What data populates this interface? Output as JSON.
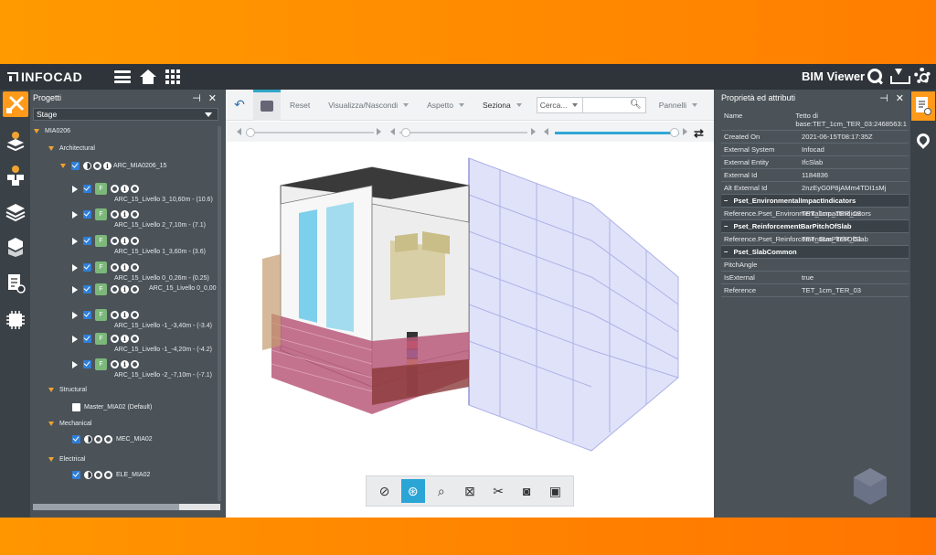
{
  "app": {
    "logo": "INFOCAD",
    "viewer_title": "BIM Viewer",
    "icons": [
      "hamburger-icon",
      "home-icon",
      "grid-icon",
      "search-icon",
      "download-icon",
      "gear-icon"
    ]
  },
  "projects_panel": {
    "title": "Progetti",
    "stage_value": "Stage",
    "tree": {
      "root": "MIA0206",
      "architectural": "Architectural",
      "arc_model": "ARC_MIA0206_15",
      "levels": [
        "ARC_15_Livello 3_10,60m - (10.6)",
        "ARC_15_Livello 2_7,10m - (7.1)",
        "ARC_15_Livello 1_3,60m - (3.6)",
        "ARC_15_Livello 0_0,26m - (0.25)",
        "ARC_15_Livello 0_0,00",
        "ARC_15_Livello -1_-3,40m - (-3.4)",
        "ARC_15_Livello -1_-4,20m - (-4.2)",
        "ARC_15_Livello -2_-7,10m - (-7.1)"
      ],
      "structural": "Structural",
      "structural_model": "Master_MIA02 (Default)",
      "mechanical": "Mechanical",
      "mechanical_model": "MEC_MIA02",
      "electrical": "Electrical",
      "electrical_model": "ELE_MIA02",
      "f_badge": "F",
      "info_glyph": "i"
    }
  },
  "toolbar": {
    "reset": "Reset",
    "visibility": "Visualizza/Nascondi",
    "appearance": "Aspetto",
    "section": "Seziona",
    "search_placeholder": "Cerca...",
    "panels": "Pannelli"
  },
  "properties_panel": {
    "title": "Proprietà ed attributi",
    "rows": [
      {
        "k": "Name",
        "v": "Tetto di base:TET_1cm_TER_03:2468563:1"
      },
      {
        "k": "Created On",
        "v": "2021-06-15T08:17:35Z"
      },
      {
        "k": "External System",
        "v": "Infocad"
      },
      {
        "k": "External Entity",
        "v": "IfcSlab"
      },
      {
        "k": "External Id",
        "v": "1184836"
      },
      {
        "k": "Alt External Id",
        "v": "2nzEyG0P8jAMm4TDI1sMj"
      }
    ],
    "section1": "Pset_EnvironmentalImpactIndicators",
    "section1_rows": [
      {
        "k": "Reference.Pset_EnvironmentalImpactIndicators",
        "v": "TET_1cm_TER_03"
      }
    ],
    "section2": "Pset_ReinforcementBarPitchOfSlab",
    "section2_rows": [
      {
        "k": "Reference.Pset_ReinforcementBarPitchOfSlab",
        "v": "TET_1cm_TER_03"
      }
    ],
    "section3": "Pset_SlabCommon",
    "section3_rows": [
      {
        "k": "PitchAngle",
        "v": ""
      },
      {
        "k": "IsExternal",
        "v": "true"
      },
      {
        "k": "Reference",
        "v": "TET_1cm_TER_03"
      }
    ],
    "collapse_glyph": "−"
  },
  "colors": {
    "accent_orange": "#ff9a1a",
    "checkbox_blue": "#2f7fd8",
    "toolbar_blue": "#2aa5d6"
  }
}
